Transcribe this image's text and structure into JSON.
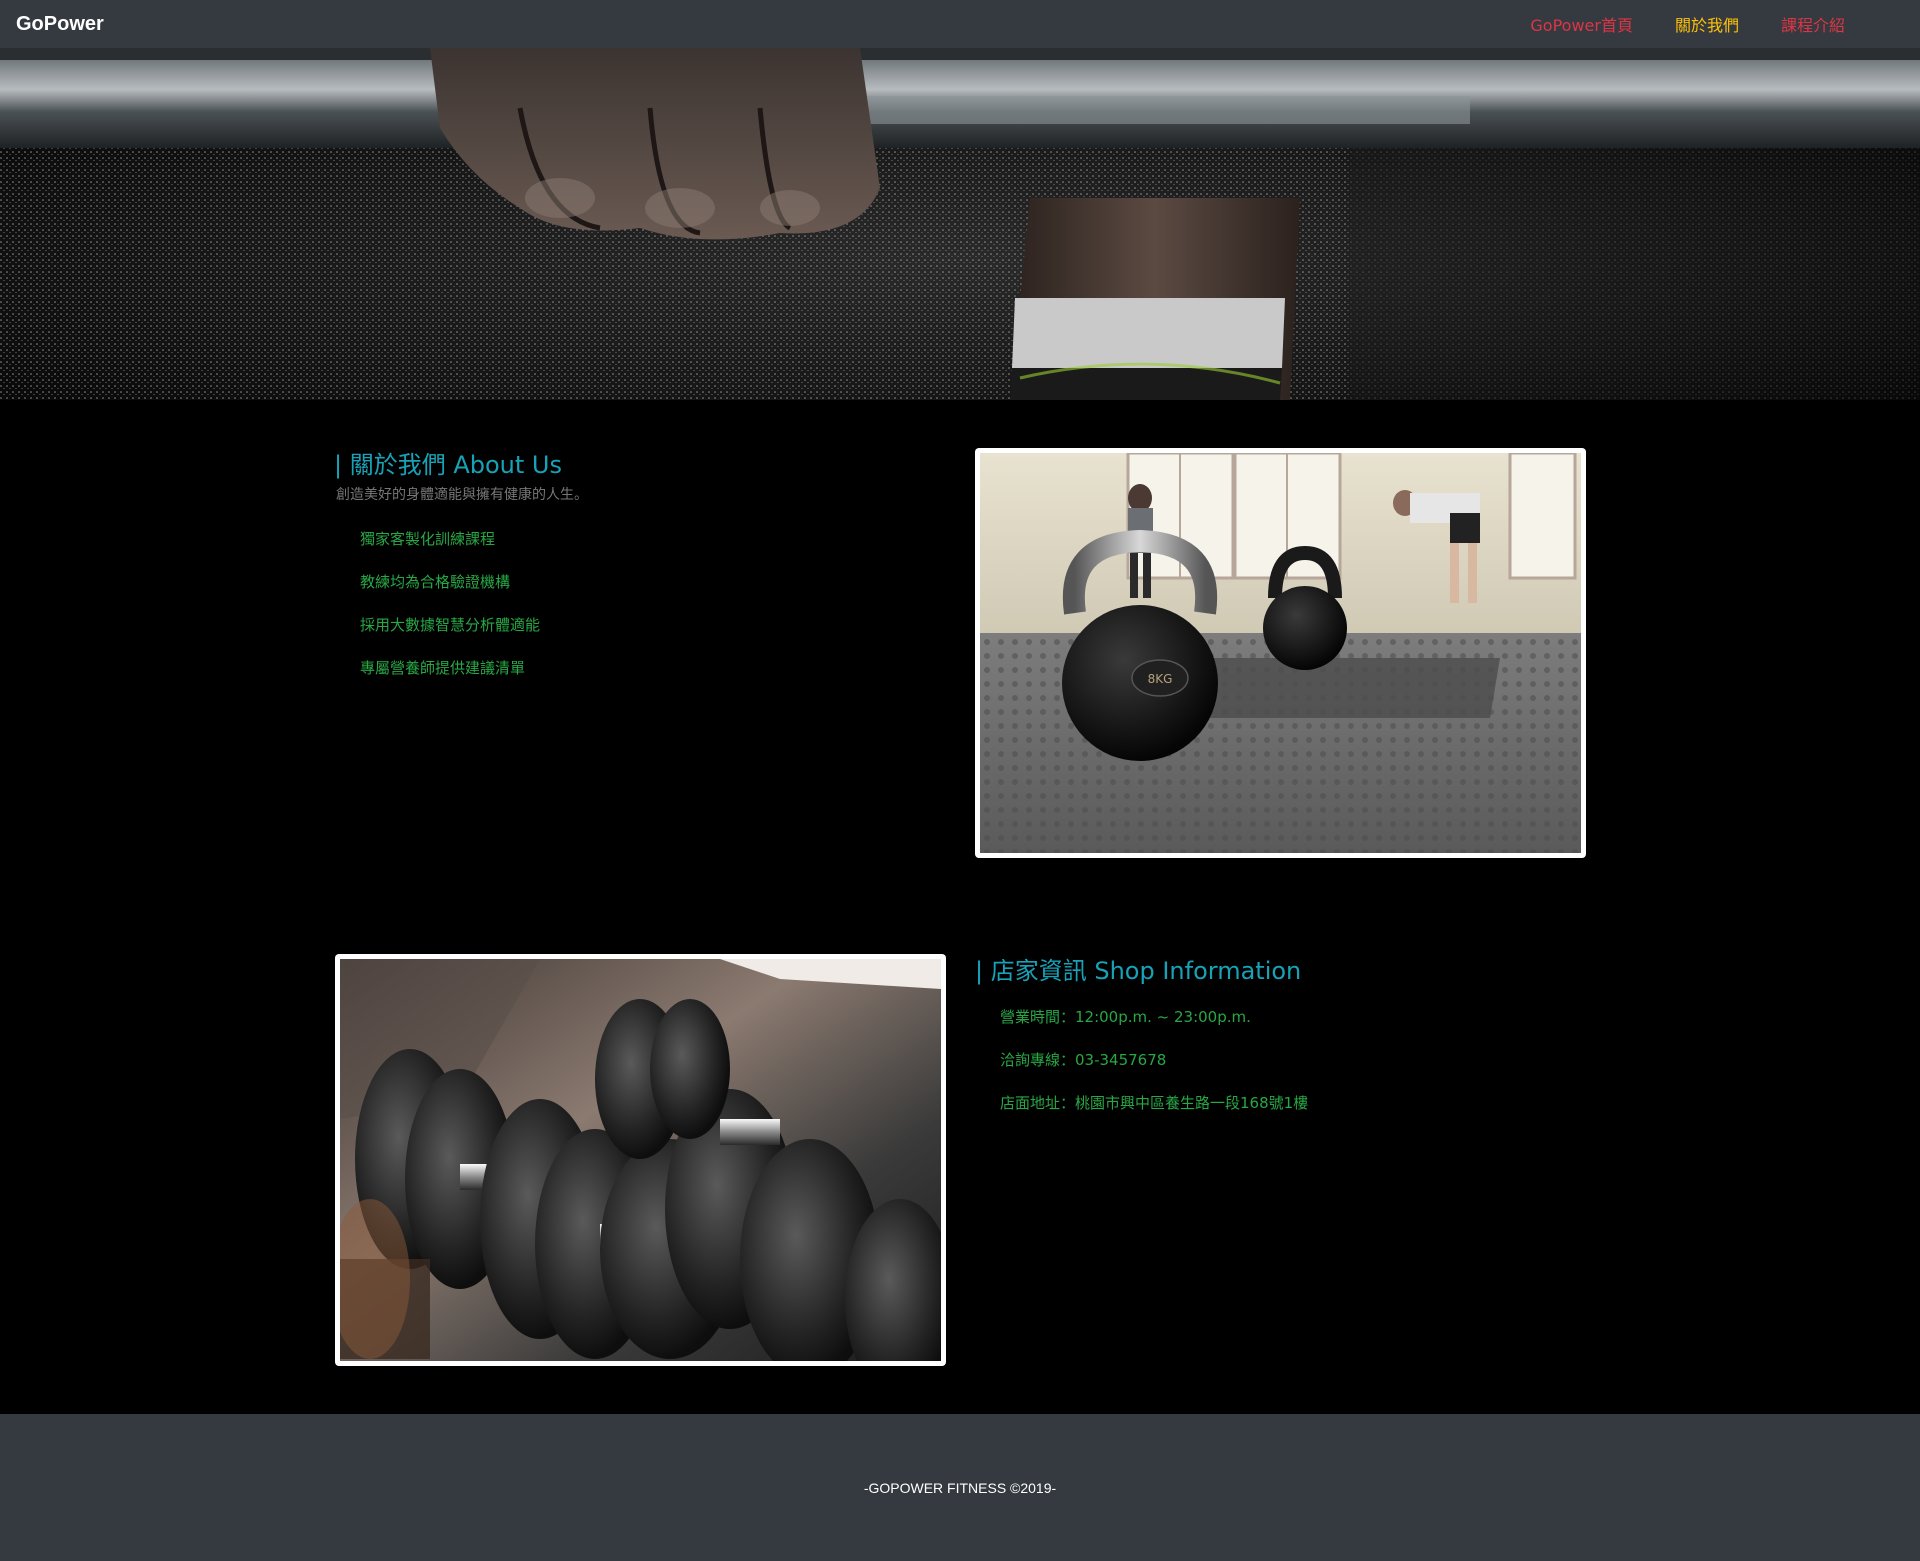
{
  "brand": "GoPower",
  "colors": {
    "nav_bg": "#343a40",
    "nav_link": "#dc3545",
    "nav_link_active": "#ffc107",
    "heading": "#17a2b8",
    "feature_text": "#28a745",
    "subtitle": "#777777",
    "footer_bg": "#343a40"
  },
  "nav": {
    "items": [
      {
        "label": "GoPower首頁",
        "active": false
      },
      {
        "label": "關於我們",
        "active": true
      },
      {
        "label": "課程介紹",
        "active": false
      }
    ]
  },
  "about": {
    "title": "| 關於我們 About Us",
    "subtitle": "創造美好的身體適能與擁有健康的人生。",
    "features": [
      "獨家客製化訓練課程",
      "教練均為合格驗證機構",
      "採用大數據智慧分析體適能",
      "專屬營養師提供建議清單"
    ]
  },
  "shop": {
    "title": "| 店家資訊 Shop Information",
    "info": [
      "營業時間：12:00p.m. ~ 23:00p.m.",
      "洽詢專線：03-3457678",
      "店面地址：桃園市興中區養生路一段168號1樓"
    ]
  },
  "images": {
    "kettlebell_label": "8KG"
  },
  "footer": {
    "text": "-GOPOWER FITNESS ©2019-"
  }
}
